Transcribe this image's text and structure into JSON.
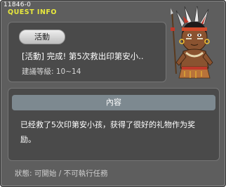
{
  "header": {
    "quest_id": "11846-0",
    "title": "QUEST INFO"
  },
  "quest": {
    "category": "活動",
    "name": "[活動] 完成! 第5次救出印第安小..",
    "level": "建議等級: 10~14"
  },
  "content": {
    "header": "內容",
    "text": "已经救了5次印第安小孩，获得了很好的礼物作为奖励。"
  },
  "status": {
    "text": "狀態:  可開始  /  不可執行任務"
  },
  "colors": {
    "window_bg": "#5e5e5e",
    "panel_bg": "#4a4a4a",
    "title_yellow": "#e9e93c",
    "content_header_bg": "#7d8990"
  },
  "icons": {
    "npc_portrait": "native-chief-npc-icon"
  }
}
